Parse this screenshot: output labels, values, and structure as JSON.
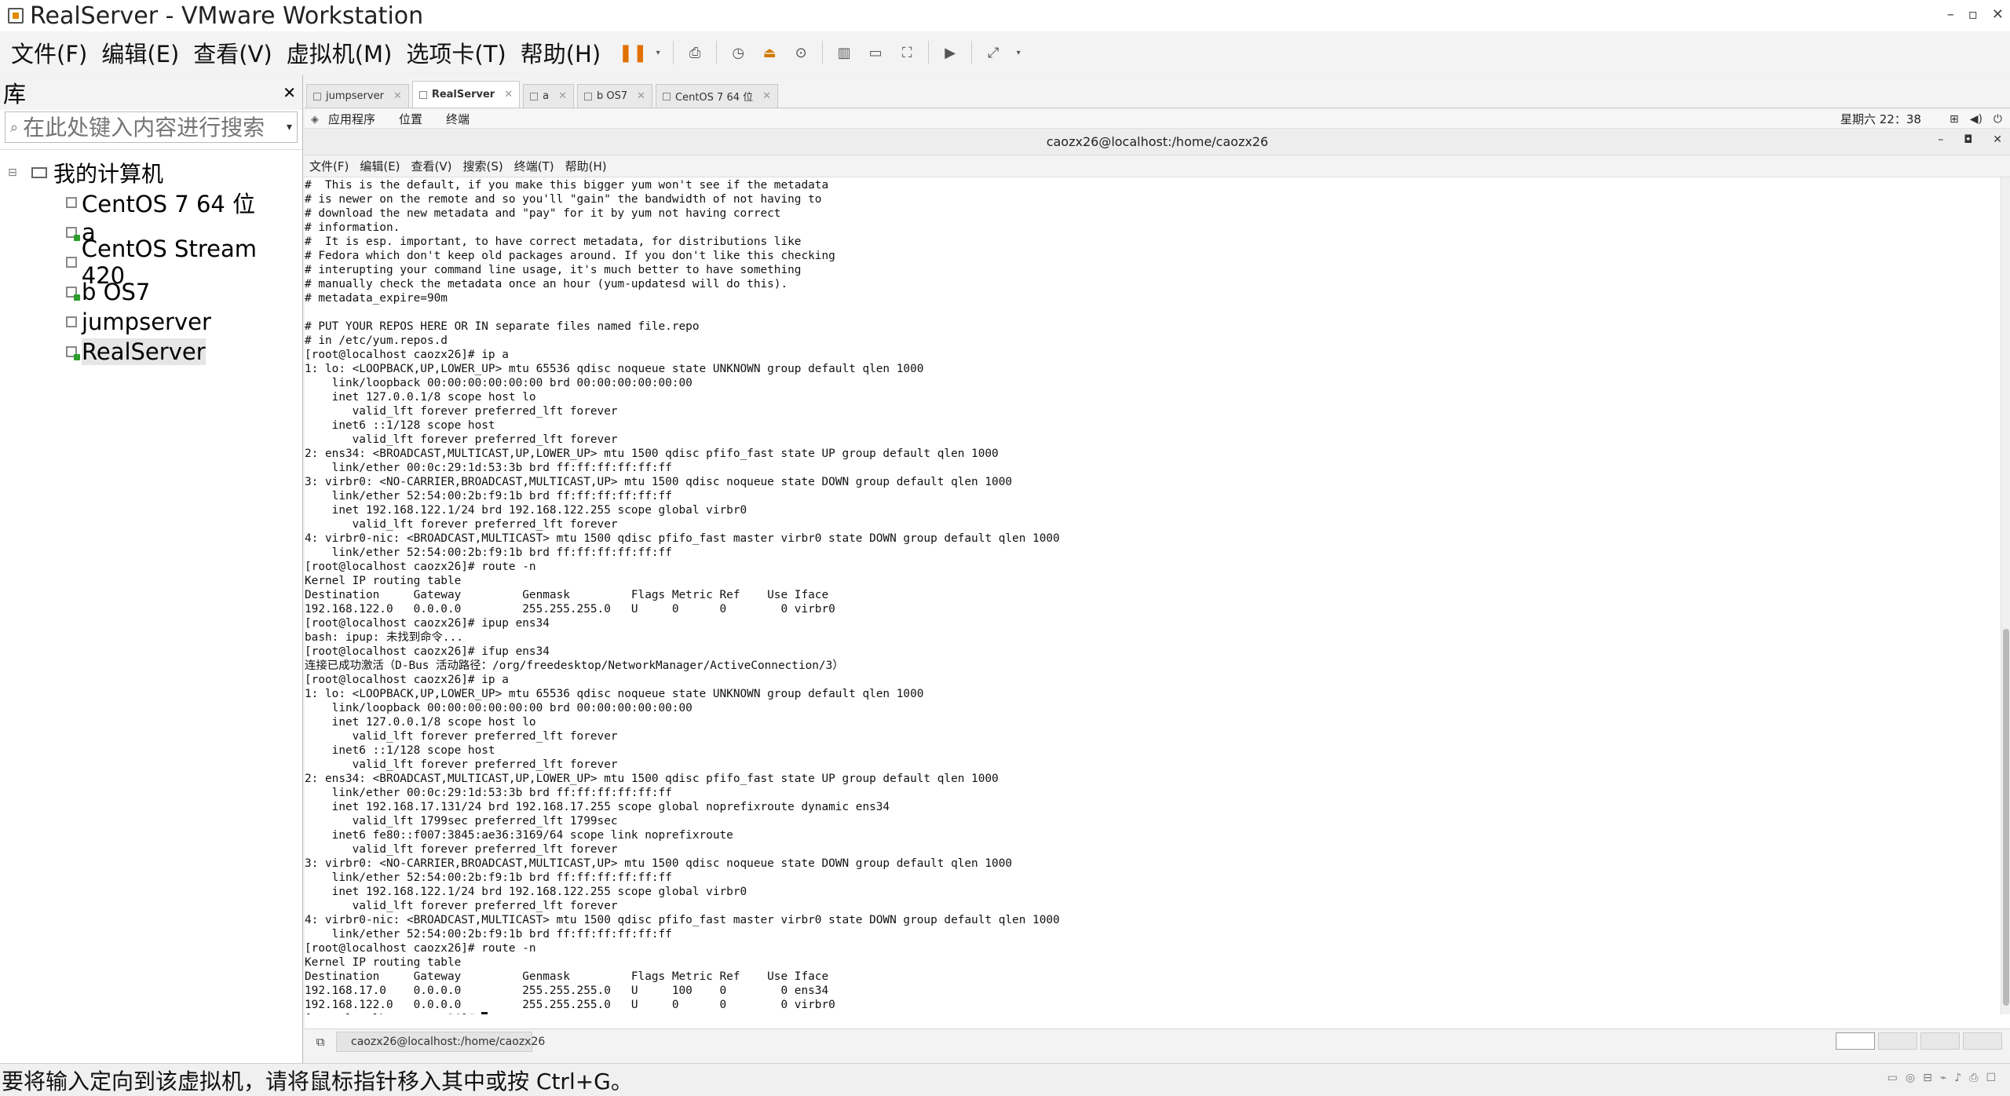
{
  "window": {
    "title": "RealServer - VMware Workstation"
  },
  "menu": [
    "文件(F)",
    "编辑(E)",
    "查看(V)",
    "虚拟机(M)",
    "选项卡(T)",
    "帮助(H)"
  ],
  "library": {
    "title": "库",
    "search_placeholder": "在此处键入内容进行搜索",
    "root": "我的计算机",
    "items": [
      "CentOS 7 64 位",
      "a",
      "CentOS Stream 420",
      "b OS7",
      "jumpserver",
      "RealServer"
    ]
  },
  "tabs": [
    "jumpserver",
    "RealServer",
    "a",
    "b OS7",
    "CentOS 7 64 位"
  ],
  "gnome": {
    "apps": "应用程序",
    "places": "位置",
    "terminal": "终端",
    "clock": "星期六 22：38"
  },
  "terminal": {
    "title": "caozx26@localhost:/home/caozx26",
    "menu": [
      "文件(F)",
      "编辑(E)",
      "查看(V)",
      "搜索(S)",
      "终端(T)",
      "帮助(H)"
    ],
    "lines": [
      "#  This is the default, if you make this bigger yum won't see if the metadata",
      "# is newer on the remote and so you'll \"gain\" the bandwidth of not having to",
      "# download the new metadata and \"pay\" for it by yum not having correct",
      "# information.",
      "#  It is esp. important, to have correct metadata, for distributions like",
      "# Fedora which don't keep old packages around. If you don't like this checking",
      "# interupting your command line usage, it's much better to have something",
      "# manually check the metadata once an hour (yum-updatesd will do this).",
      "# metadata_expire=90m",
      "",
      "# PUT YOUR REPOS HERE OR IN separate files named file.repo",
      "# in /etc/yum.repos.d",
      "[root@localhost caozx26]# ip a",
      "1: lo: <LOOPBACK,UP,LOWER_UP> mtu 65536 qdisc noqueue state UNKNOWN group default qlen 1000",
      "    link/loopback 00:00:00:00:00:00 brd 00:00:00:00:00:00",
      "    inet 127.0.0.1/8 scope host lo",
      "       valid_lft forever preferred_lft forever",
      "    inet6 ::1/128 scope host",
      "       valid_lft forever preferred_lft forever",
      "2: ens34: <BROADCAST,MULTICAST,UP,LOWER_UP> mtu 1500 qdisc pfifo_fast state UP group default qlen 1000",
      "    link/ether 00:0c:29:1d:53:3b brd ff:ff:ff:ff:ff:ff",
      "3: virbr0: <NO-CARRIER,BROADCAST,MULTICAST,UP> mtu 1500 qdisc noqueue state DOWN group default qlen 1000",
      "    link/ether 52:54:00:2b:f9:1b brd ff:ff:ff:ff:ff:ff",
      "    inet 192.168.122.1/24 brd 192.168.122.255 scope global virbr0",
      "       valid_lft forever preferred_lft forever",
      "4: virbr0-nic: <BROADCAST,MULTICAST> mtu 1500 qdisc pfifo_fast master virbr0 state DOWN group default qlen 1000",
      "    link/ether 52:54:00:2b:f9:1b brd ff:ff:ff:ff:ff:ff",
      "[root@localhost caozx26]# route -n",
      "Kernel IP routing table",
      "Destination     Gateway         Genmask         Flags Metric Ref    Use Iface",
      "192.168.122.0   0.0.0.0         255.255.255.0   U     0      0        0 virbr0",
      "[root@localhost caozx26]# ipup ens34",
      "bash: ipup: 未找到命令...",
      "[root@localhost caozx26]# ifup ens34",
      "连接已成功激活（D-Bus 活动路径：/org/freedesktop/NetworkManager/ActiveConnection/3）",
      "[root@localhost caozx26]# ip a",
      "1: lo: <LOOPBACK,UP,LOWER_UP> mtu 65536 qdisc noqueue state UNKNOWN group default qlen 1000",
      "    link/loopback 00:00:00:00:00:00 brd 00:00:00:00:00:00",
      "    inet 127.0.0.1/8 scope host lo",
      "       valid_lft forever preferred_lft forever",
      "    inet6 ::1/128 scope host",
      "       valid_lft forever preferred_lft forever",
      "2: ens34: <BROADCAST,MULTICAST,UP,LOWER_UP> mtu 1500 qdisc pfifo_fast state UP group default qlen 1000",
      "    link/ether 00:0c:29:1d:53:3b brd ff:ff:ff:ff:ff:ff",
      "    inet 192.168.17.131/24 brd 192.168.17.255 scope global noprefixroute dynamic ens34",
      "       valid_lft 1799sec preferred_lft 1799sec",
      "    inet6 fe80::f007:3845:ae36:3169/64 scope link noprefixroute",
      "       valid_lft forever preferred_lft forever",
      "3: virbr0: <NO-CARRIER,BROADCAST,MULTICAST,UP> mtu 1500 qdisc noqueue state DOWN group default qlen 1000",
      "    link/ether 52:54:00:2b:f9:1b brd ff:ff:ff:ff:ff:ff",
      "    inet 192.168.122.1/24 brd 192.168.122.255 scope global virbr0",
      "       valid_lft forever preferred_lft forever",
      "4: virbr0-nic: <BROADCAST,MULTICAST> mtu 1500 qdisc pfifo_fast master virbr0 state DOWN group default qlen 1000",
      "    link/ether 52:54:00:2b:f9:1b brd ff:ff:ff:ff:ff:ff",
      "[root@localhost caozx26]# route -n",
      "Kernel IP routing table",
      "Destination     Gateway         Genmask         Flags Metric Ref    Use Iface",
      "192.168.17.0    0.0.0.0         255.255.255.0   U     100    0        0 ens34",
      "192.168.122.0   0.0.0.0         255.255.255.0   U     0      0        0 virbr0"
    ],
    "prompt": "[root@localhost caozx26]# "
  },
  "taskbar": {
    "task_label": "caozx26@localhost:/home/caozx26"
  },
  "status": {
    "message": "要将输入定向到该虚拟机，请将鼠标指针移入其中或按 Ctrl+G。"
  },
  "colors": {
    "pause": "#e07000",
    "running": "#2c9e2c"
  }
}
